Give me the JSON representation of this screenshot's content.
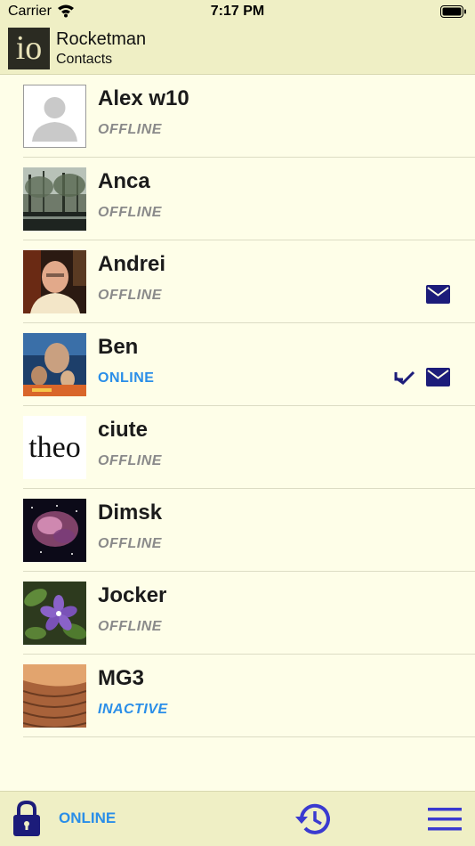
{
  "statusbar": {
    "carrier": "Carrier",
    "time": "7:17 PM"
  },
  "header": {
    "logo_text": "io",
    "title": "Rocketman",
    "subtitle": "Contacts"
  },
  "contacts": [
    {
      "name": "Alex w10",
      "status": "OFFLINE",
      "avatar": "default-person"
    },
    {
      "name": "Anca",
      "status": "OFFLINE",
      "avatar": "forest-photo"
    },
    {
      "name": "Andrei",
      "status": "OFFLINE",
      "avatar": "man-portrait"
    },
    {
      "name": "Ben",
      "status": "ONLINE",
      "avatar": "movie-poster"
    },
    {
      "name": "ciute",
      "status": "OFFLINE",
      "avatar": "theo-text",
      "avatar_text": "theo"
    },
    {
      "name": "Dimsk",
      "status": "OFFLINE",
      "avatar": "nebula-photo"
    },
    {
      "name": "Jocker",
      "status": "OFFLINE",
      "avatar": "purple-flower"
    },
    {
      "name": "MG3",
      "status": "INACTIVE",
      "avatar": "sand-dune"
    }
  ],
  "footer": {
    "status": "ONLINE"
  },
  "colors": {
    "accent_blue": "#2a8ee8",
    "icon_navy": "#1c1c7a",
    "bar_bg": "#efefc5",
    "page_bg": "#fefee8"
  }
}
